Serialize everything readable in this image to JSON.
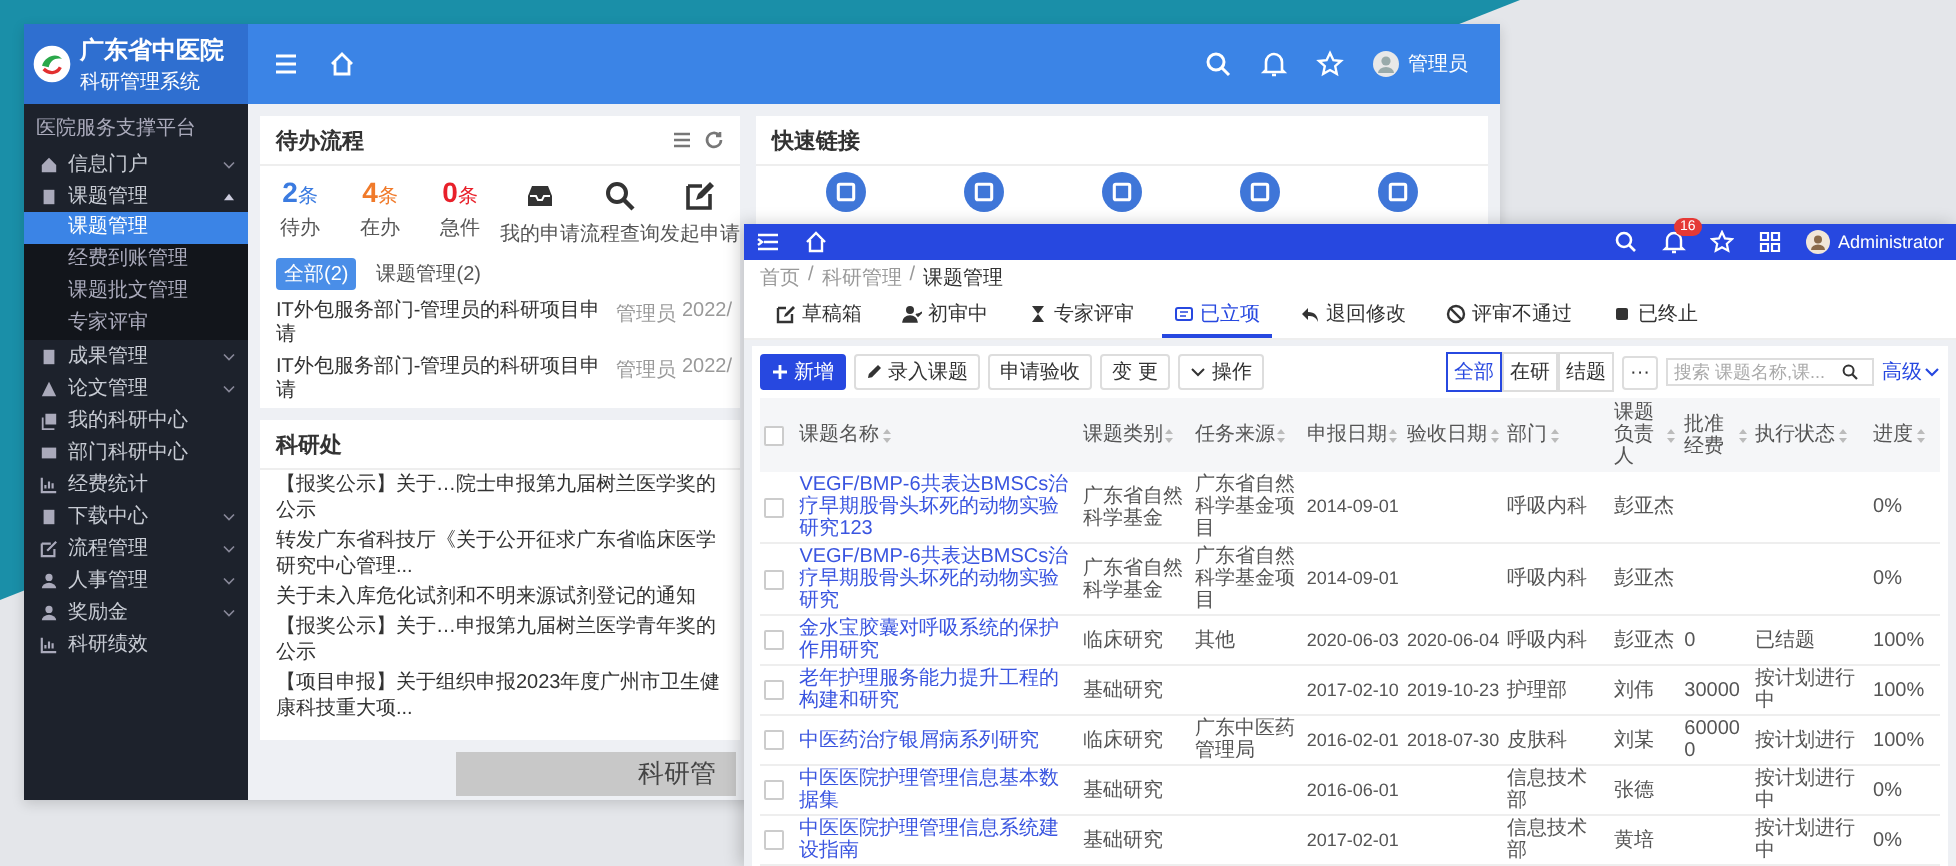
{
  "left_window": {
    "logo": {
      "line1": "广东省中医院",
      "line2": "科研管理系统"
    },
    "user": "管理员",
    "sidebar": {
      "heading": "医院服务支撑平台",
      "items": [
        {
          "label": "信息门户",
          "kind": "group",
          "expanded": false
        },
        {
          "label": "课题管理",
          "kind": "group",
          "expanded": true,
          "children": [
            {
              "label": "课题管理",
              "selected": true
            },
            {
              "label": "经费到账管理",
              "selected": false
            },
            {
              "label": "课题批文管理",
              "selected": false
            },
            {
              "label": "专家评审",
              "selected": false
            }
          ]
        },
        {
          "label": "成果管理",
          "kind": "group",
          "expanded": false
        },
        {
          "label": "论文管理",
          "kind": "group",
          "expanded": false
        },
        {
          "label": "我的科研中心",
          "kind": "link"
        },
        {
          "label": "部门科研中心",
          "kind": "link"
        },
        {
          "label": "经费统计",
          "kind": "link"
        },
        {
          "label": "下载中心",
          "kind": "group",
          "expanded": false
        },
        {
          "label": "流程管理",
          "kind": "group",
          "expanded": false
        },
        {
          "label": "人事管理",
          "kind": "group",
          "expanded": false
        },
        {
          "label": "奖励金",
          "kind": "group",
          "expanded": false
        },
        {
          "label": "科研绩效",
          "kind": "link"
        }
      ]
    },
    "todo": {
      "title": "待办流程",
      "stats": [
        {
          "count": "2",
          "unit": "条",
          "label": "待办",
          "color": "#3b7be0"
        },
        {
          "count": "4",
          "unit": "条",
          "label": "在办",
          "color": "#f07a2a"
        },
        {
          "count": "0",
          "unit": "条",
          "label": "急件",
          "color": "#e8202a"
        }
      ],
      "actions": [
        {
          "label": "我的申请"
        },
        {
          "label": "流程查询"
        },
        {
          "label": "发起申请"
        }
      ],
      "filters": [
        {
          "label": "全部(2)",
          "selected": true
        },
        {
          "label": "课题管理(2)",
          "selected": false
        }
      ],
      "rows": [
        {
          "title": "IT外包服务部门-管理员的科研项目申请",
          "user": "管理员",
          "date": "2022/"
        },
        {
          "title": "IT外包服务部门-管理员的科研项目申请",
          "user": "管理员",
          "date": "2022/"
        }
      ]
    },
    "quick_links": {
      "title": "快速链接"
    },
    "notices": {
      "title": "科研处",
      "items": [
        "【报奖公示】关于…院士申报第九届树兰医学奖的公示",
        "转发广东省科技厅《关于公开征求广东省临床医学研究中心管理...",
        "关于未入库危化试剂和不明来源试剂登记的通知",
        "【报奖公示】关于…申报第九届树兰医学青年奖的公示",
        "【项目申报】关于组织申报2023年度广州市卫生健康科技重大项..."
      ]
    },
    "banner": "科研管"
  },
  "right_window": {
    "user": "Administrator",
    "notification_count": "16",
    "breadcrumb": [
      "首页",
      "科研管理",
      "课题管理"
    ],
    "breadcrumb_separator": "/",
    "tabs": [
      {
        "label": "草稿箱",
        "selected": false
      },
      {
        "label": "初审中",
        "selected": false
      },
      {
        "label": "专家评审",
        "selected": false
      },
      {
        "label": "已立项",
        "selected": true
      },
      {
        "label": "退回修改",
        "selected": false
      },
      {
        "label": "评审不通过",
        "selected": false
      },
      {
        "label": "已终止",
        "selected": false
      }
    ],
    "toolbar": [
      {
        "label": "新增",
        "kind": "primary"
      },
      {
        "label": "录入课题",
        "kind": "edit"
      },
      {
        "label": "申请验收",
        "kind": "plain"
      },
      {
        "label": "变 更",
        "kind": "plain"
      },
      {
        "label": "操作",
        "kind": "dropdown"
      }
    ],
    "filters": [
      {
        "label": "全部",
        "selected": true
      },
      {
        "label": "在研",
        "selected": false
      },
      {
        "label": "结题",
        "selected": false
      }
    ],
    "more": "···",
    "search": {
      "placeholder": "搜索 课题名称,课..."
    },
    "advanced": "高级",
    "table": {
      "select_all_checked": false,
      "columns": [
        "课题名称",
        "课题类别",
        "任务来源",
        "申报日期",
        "验收日期",
        "部门",
        "课题负责人",
        "批准经费",
        "执行状态",
        "进度"
      ],
      "rows": [
        {
          "checked": false,
          "cells": [
            "VEGF/BMP-6共表达BMSCs治疗早期股骨头坏死的动物实验研究123",
            "广东省自然科学基金",
            "广东省自然科学基金项目",
            "2014-09-01",
            "",
            "呼吸内科",
            "彭亚杰",
            "",
            "",
            "0%"
          ]
        },
        {
          "checked": false,
          "cells": [
            "VEGF/BMP-6共表达BMSCs治疗早期股骨头坏死的动物实验研究",
            "广东省自然科学基金",
            "广东省自然科学基金项目",
            "2014-09-01",
            "",
            "呼吸内科",
            "彭亚杰",
            "",
            "",
            "0%"
          ]
        },
        {
          "checked": false,
          "cells": [
            "金水宝胶囊对呼吸系统的保护作用研究",
            "临床研究",
            "其他",
            "2020-06-03",
            "2020-06-04",
            "呼吸内科",
            "彭亚杰",
            "0",
            "已结题",
            "100%"
          ]
        },
        {
          "checked": false,
          "cells": [
            "老年护理服务能力提升工程的构建和研究",
            "基础研究",
            "",
            "2017-02-10",
            "2019-10-23",
            "护理部",
            "刘伟",
            "30000",
            "按计划进行中",
            "100%"
          ]
        },
        {
          "checked": false,
          "cells": [
            "中医药治疗银屑病系列研究",
            "临床研究",
            "广东中医药管理局",
            "2016-02-01",
            "2018-07-30",
            "皮肤科",
            "刘某",
            "600000",
            "按计划进行",
            "100%"
          ]
        },
        {
          "checked": false,
          "cells": [
            "中医医院护理管理信息基本数据集",
            "基础研究",
            "",
            "2016-06-01",
            "",
            "信息技术部",
            "张德",
            "",
            "按计划进行中",
            "0%"
          ]
        },
        {
          "checked": false,
          "cells": [
            "中医医院护理管理信息系统建设指南",
            "基础研究",
            "",
            "2017-02-01",
            "",
            "信息技术部",
            "黄培",
            "",
            "按计划进行中",
            "0%"
          ]
        }
      ]
    }
  }
}
